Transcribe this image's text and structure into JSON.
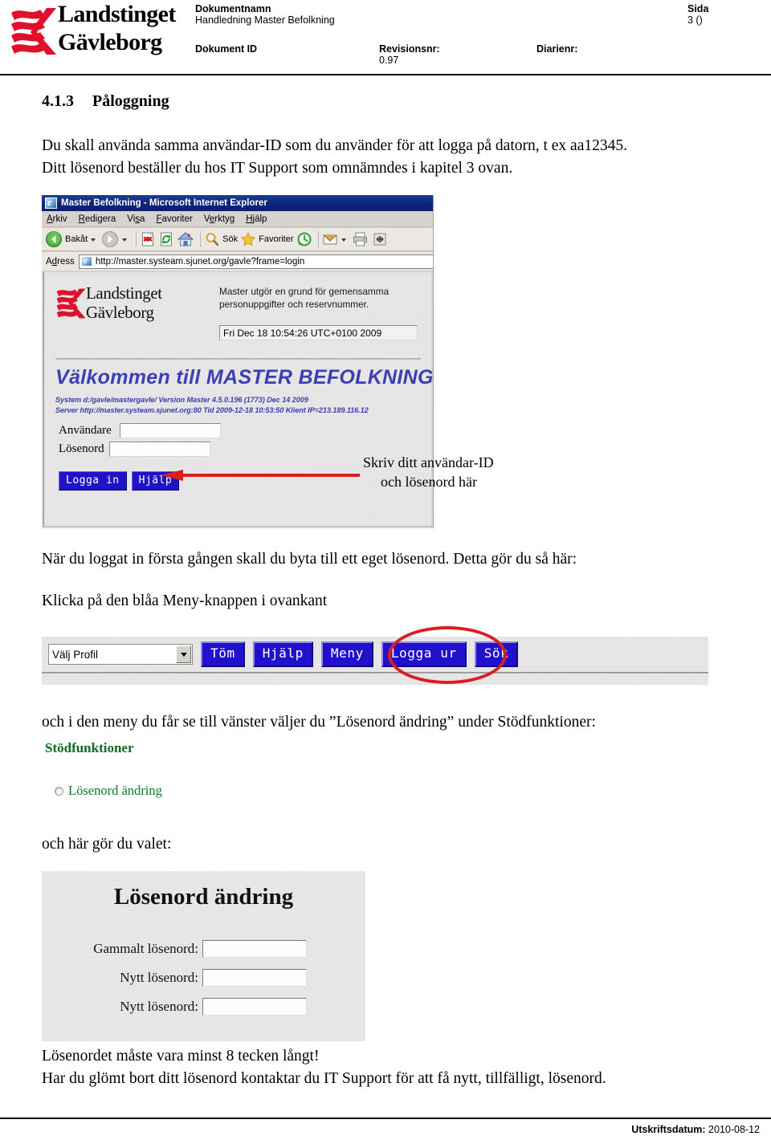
{
  "header": {
    "logo": {
      "line1": "Landstinget",
      "line2": "Gävleborg",
      "mark_color": "#e1102a"
    },
    "docname_label": "Dokumentnamn",
    "docname_value": "Handledning Master Befolkning",
    "sida_label": "Sida",
    "sida_value": "3 ()",
    "docid_label": "Dokument ID",
    "revision_label": "Revisionsnr:",
    "revision_value": "0.97",
    "diarienr_label": "Diarienr:"
  },
  "section": {
    "number": "4.1.3",
    "title": "Påloggning"
  },
  "paragraphs": {
    "intro_line1": "Du skall använda samma användar-ID som du använder för att logga på datorn, t ex aa12345.",
    "intro_line2": "Ditt lösenord beställer du hos IT Support som omnämndes i kapitel 3 ovan.",
    "after_login": "När du loggat in första gången skall du byta till ett eget lösenord. Detta gör du så här:",
    "click_meny": "Klicka på den blåa Meny-knappen i ovankant",
    "menu_instruction": "och i den meny du får se till vänster väljer du ”Lösenord ändring” under Stödfunktioner:",
    "here_choose": "och här gör du valet:",
    "min_chars": "Lösenordet måste vara minst 8 tecken långt!",
    "forgot": "Har du glömt bort ditt lösenord kontaktar du IT Support för att få nytt, tillfälligt, lösenord."
  },
  "browser": {
    "title": "Master Befolkning - Microsoft Internet Explorer",
    "menu_items": [
      "Arkiv",
      "Redigera",
      "Visa",
      "Favoriter",
      "Verktyg",
      "Hjälp"
    ],
    "toolbar": {
      "back_label": "Bakåt",
      "search_label": "Sök",
      "favorites_label": "Favoriter"
    },
    "address_label": "Adress",
    "address_url": "http://master.systeam.sjunet.org/gavle?frame=login"
  },
  "login_page": {
    "brand_line1": "Landstinget",
    "brand_line2": "Gävleborg",
    "intro_line1": "Master utgör en grund för gemensamma",
    "intro_line2": "personuppgifter och reservnummer.",
    "clock": "Fri Dec 18 10:54:26 UTC+0100 2009",
    "welcome": "Välkommen till MASTER BEFOLKNING",
    "sysline1": "System d:/gavle/mastergavle/ Version Master 4.5.0.196 (1773) Dec 14 2009",
    "sysline2": "Server http://master.systeam.sjunet.org:80 Tid 2009-12-18 10:53:50 Klient IP=213.189.116.12",
    "user_label": "Användare",
    "pass_label": "Lösenord",
    "user_value": "",
    "pass_value": "",
    "login_button": "Logga in",
    "help_button": "Hjälp",
    "welcome_color": "#3b3fb4",
    "button_color": "#1f12c8"
  },
  "annotation": {
    "line1": "Skriv ditt användar-ID",
    "line2": "och lösenord här",
    "arrow_color": "#d81f20"
  },
  "menu_toolbar": {
    "profile_select_value": "Välj Profil",
    "buttons": [
      "Töm",
      "Hjälp",
      "Meny",
      "Logga ur",
      "Sök"
    ],
    "highlighted_button": "Meny",
    "highlight_color": "#d81f20",
    "button_color": "#2211cc"
  },
  "stodfunktioner": {
    "title": "Stödfunktioner",
    "title_color": "#0b6b23",
    "option_label": "Lösenord ändring",
    "option_color": "#0f7b2a",
    "option_selected": false
  },
  "password_dialog": {
    "title": "Lösenord ändring",
    "rows": [
      {
        "label": "Gammalt lösenord:",
        "value": ""
      },
      {
        "label": "Nytt lösenord:",
        "value": ""
      },
      {
        "label": "Nytt lösenord:",
        "value": ""
      }
    ]
  },
  "footer": {
    "label": "Utskriftsdatum:",
    "value": "2010-08-12"
  }
}
